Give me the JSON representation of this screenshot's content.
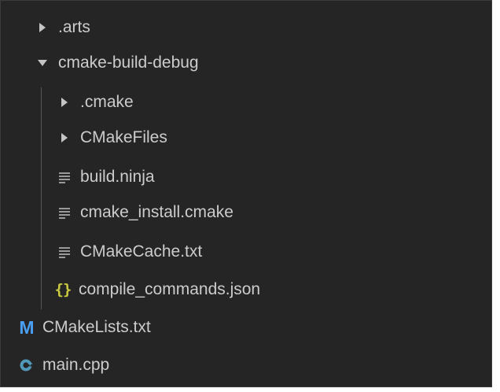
{
  "colors": {
    "panel_bg": "#252526",
    "text": "#cccccc",
    "chevron": "#c5c5c5",
    "lines_icon": "#9a9a9a",
    "json_icon": "#cbcb41",
    "cmake_icon": "#4aa0f0",
    "cpp_icon": "#519aba",
    "indent_guide": "#585858"
  },
  "tree": {
    "arts": {
      "label": ".arts",
      "expanded": false,
      "icon": "chevron-right-icon"
    },
    "cmake_build_debug": {
      "label": "cmake-build-debug",
      "expanded": true,
      "icon": "chevron-down-icon",
      "children": {
        "cmake": {
          "label": ".cmake",
          "expanded": false,
          "icon": "chevron-right-icon"
        },
        "cmakefiles": {
          "label": "CMakeFiles",
          "expanded": false,
          "icon": "chevron-right-icon"
        },
        "build_ninja": {
          "label": "build.ninja",
          "icon": "lines-file-icon"
        },
        "cmake_install": {
          "label": "cmake_install.cmake",
          "icon": "lines-file-icon"
        },
        "cmakecache": {
          "label": "CMakeCache.txt",
          "icon": "lines-file-icon"
        },
        "compile_commands": {
          "label": "compile_commands.json",
          "icon": "json-braces-icon",
          "glyph": "{}"
        }
      }
    },
    "cmakelists": {
      "label": "CMakeLists.txt",
      "icon": "cmake-m-icon",
      "glyph": "M"
    },
    "main_cpp": {
      "label": "main.cpp",
      "icon": "cpp-file-icon"
    }
  }
}
